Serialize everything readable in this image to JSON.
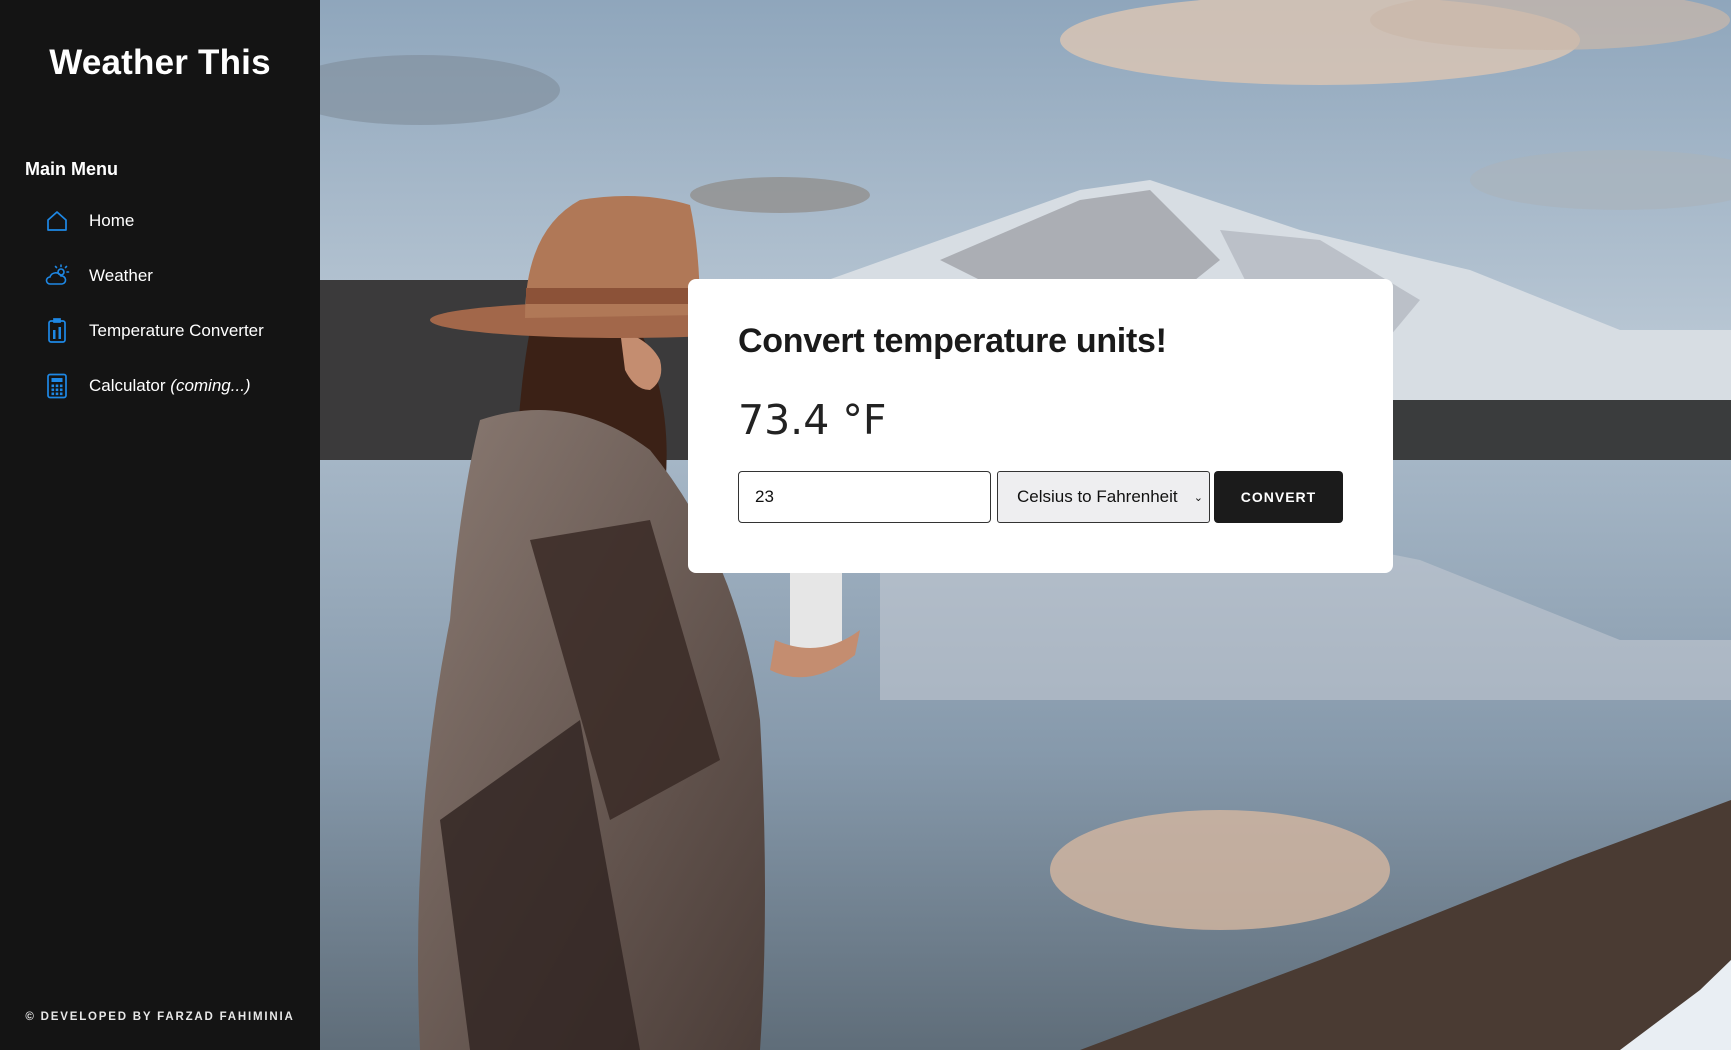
{
  "sidebar": {
    "brand": "Weather This",
    "menu_heading": "Main Menu",
    "items": [
      {
        "label": "Home",
        "icon": "home-icon"
      },
      {
        "label": "Weather",
        "icon": "weather-icon"
      },
      {
        "label": "Temperature Converter",
        "icon": "thermometer-icon"
      },
      {
        "label": "Calculator",
        "label_suffix": "(coming...)",
        "icon": "calculator-icon"
      }
    ],
    "footer": "© DEVELOPED BY FARZAD FAHIMINIA"
  },
  "converter": {
    "title": "Convert temperature units!",
    "result": "73.4 °F",
    "input_value": "23",
    "selected_option": "Celsius to Fahrenheit",
    "button_label": "CONVERT"
  },
  "colors": {
    "sidebar_bg": "#141414",
    "icon_accent": "#1e88e5",
    "button_bg": "#1b1b1b"
  }
}
